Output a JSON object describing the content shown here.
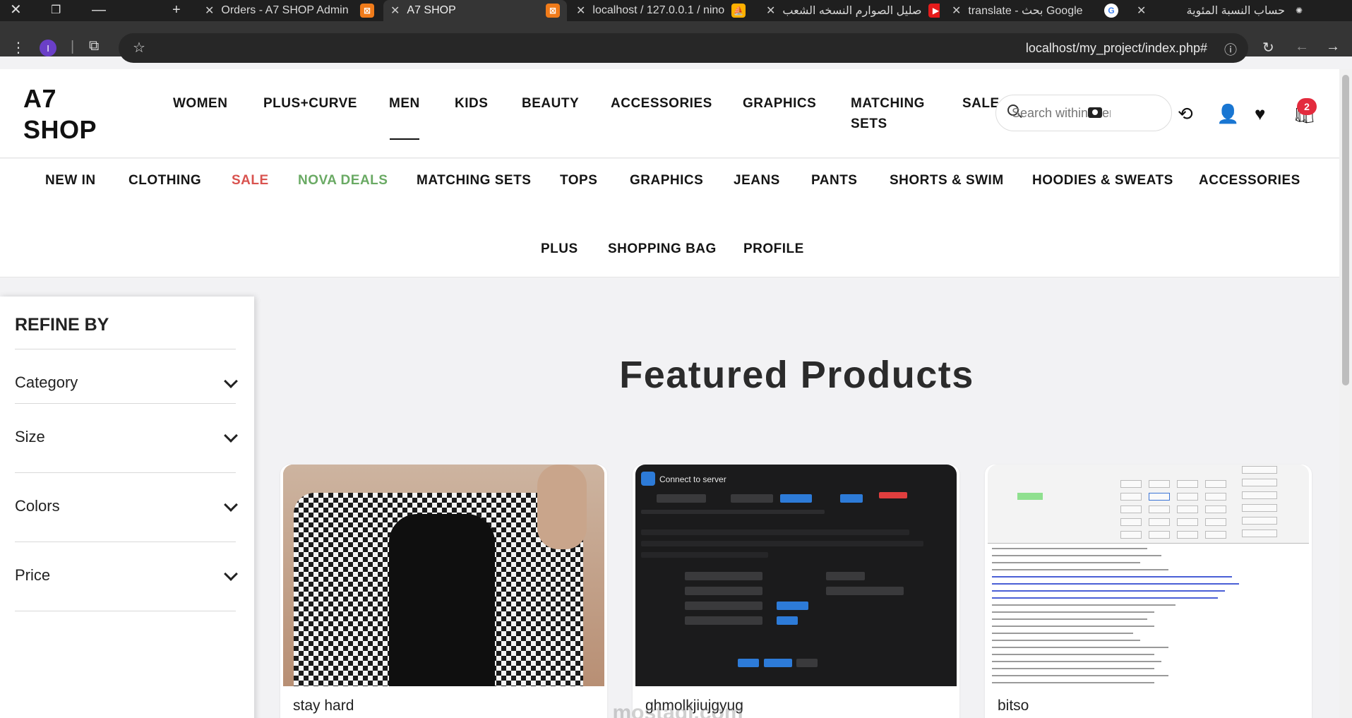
{
  "browser": {
    "tabs": [
      {
        "title": "Orders - A7 SHOP Admin",
        "favicon": "xampp-icon"
      },
      {
        "title": "A7 SHOP",
        "favicon": "xampp-icon",
        "active": true
      },
      {
        "title": "localhost / 127.0.0.1 / nino",
        "favicon": "phpmyadmin-icon"
      },
      {
        "title": "صليل الصوارم النسخه الشعب",
        "favicon": "youtube-icon"
      },
      {
        "title": "translate - بحث Google",
        "favicon": "google-icon"
      },
      {
        "title": "حساب النسبة المئوية",
        "favicon": "chatgpt-icon"
      }
    ],
    "profile_initial": "I",
    "url": "localhost/my_project/index.php#"
  },
  "site": {
    "logo_line1": "A7",
    "logo_line2": "SHOP",
    "main_nav": [
      "WOMEN",
      "PLUS+CURVE",
      "MEN",
      "KIDS",
      "BEAUTY",
      "ACCESSORIES",
      "GRAPHICS",
      "MATCHING",
      "SETS",
      "SALE"
    ],
    "search_placeholder": "Search within Men's Clothing",
    "cart_count": "2",
    "sub_nav": [
      "NEW IN",
      "CLOTHING",
      "SALE",
      "NOVA DEALS",
      "MATCHING SETS",
      "TOPS",
      "GRAPHICS",
      "JEANS",
      "PANTS",
      "SHORTS & SWIM",
      "HOODIES & SWEATS",
      "ACCESSORIES",
      "PLUS",
      "SHOPPING BAG",
      "PROFILE"
    ],
    "colors": {
      "sale": "#d9534f",
      "nova_deals": "#6aaa64",
      "badge": "#e32b3d"
    }
  },
  "sidebar": {
    "title": "REFINE BY",
    "filters": [
      "Category",
      "Size",
      "Colors",
      "Price"
    ]
  },
  "main": {
    "heading": "Featured Products",
    "products": [
      {
        "name": "stay hard"
      },
      {
        "name": "ghmolkjiujgyug"
      },
      {
        "name": "bitso"
      }
    ],
    "product2_image_title": "Connect to server"
  },
  "watermark": "mostaql.com"
}
